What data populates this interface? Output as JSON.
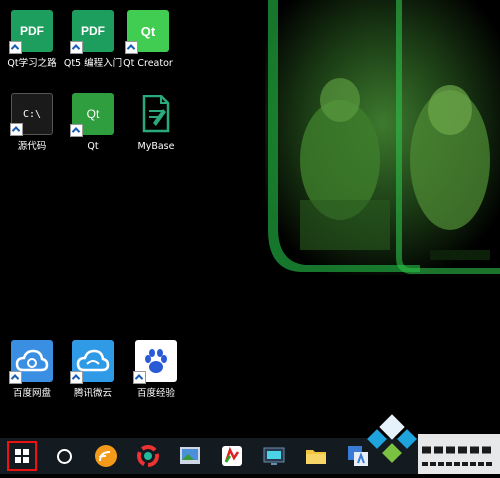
{
  "desktop": {
    "icons": [
      {
        "label": "Qt学习之路",
        "glyph": "PDF",
        "icon": "pdf-icon"
      },
      {
        "label": "Qt5 编程入门",
        "glyph": "PDF",
        "icon": "pdf-icon"
      },
      {
        "label": "Qt Creator",
        "glyph": "Qt",
        "icon": "qt-creator-icon"
      },
      {
        "label": "源代码",
        "glyph": "C:\\",
        "icon": "command-prompt-icon"
      },
      {
        "label": "Qt",
        "glyph": "Qt",
        "icon": "qt-icon"
      },
      {
        "label": "MyBase",
        "glyph": "",
        "icon": "document-icon"
      },
      {
        "label": "百度网盘",
        "glyph": "",
        "icon": "cloud-icon"
      },
      {
        "label": "腾讯微云",
        "glyph": "",
        "icon": "cloud-icon"
      },
      {
        "label": "百度经验",
        "glyph": "",
        "icon": "paw-icon"
      }
    ]
  },
  "taskbar": {
    "start_icon": "windows-logo-icon",
    "search_icon": "cortana-circle-icon",
    "apps": [
      "rss-browser-icon",
      "app-colorful-icon",
      "image-viewer-icon",
      "music-app-icon",
      "monitor-app-icon",
      "file-explorer-icon",
      "translate-app-icon"
    ]
  },
  "watermark": "系统之家 www.xitongzhijia.net"
}
